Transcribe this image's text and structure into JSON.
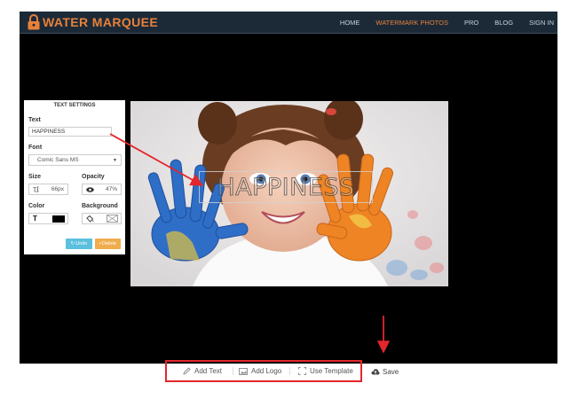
{
  "header": {
    "logo_text": "WATER MARQUEE",
    "nav": [
      "HOME",
      "WATERMARK PHOTOS",
      "PRO",
      "BLOG",
      "SIGN IN"
    ],
    "active_nav": "WATERMARK PHOTOS"
  },
  "watermark": {
    "text": "HAPPINESS"
  },
  "panel": {
    "title": "TEXT SETTINGS",
    "text_label": "Text",
    "text_value": "HAPPINESS",
    "font_label": "Font",
    "font_value": "Comic Sans MS",
    "size_label": "Size",
    "size_value": "66px",
    "opacity_label": "Opacity",
    "opacity_value": "47%",
    "color_label": "Color",
    "background_label": "Background",
    "color_swatch": "#000000",
    "undo_label": "Undo",
    "delete_label": "Delete",
    "undo_color": "#5bc0de",
    "delete_color": "#f0ad4e"
  },
  "toolbar": {
    "add_text": "Add Text",
    "add_logo": "Add Logo",
    "use_template": "Use Template",
    "save": "Save"
  },
  "colors": {
    "accent": "#e8813a",
    "highlight": "#e3262b"
  },
  "icons": [
    "lock-icon",
    "pencil-icon",
    "image-icon",
    "template-icon",
    "cloud-save-icon",
    "text-size-icon",
    "eye-icon",
    "text-color-icon",
    "fill-icon",
    "no-background-icon",
    "undo-icon",
    "trash-icon",
    "caret-down-icon"
  ]
}
